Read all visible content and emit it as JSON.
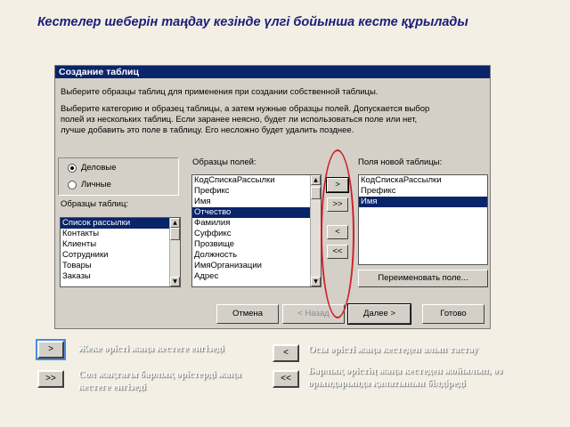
{
  "slide_title": "Кестелер шеберін таңдау кезінде үлгі бойынша кесте құрылады",
  "dialog": {
    "title": "Создание таблиц",
    "intro": "Выберите образцы таблиц для применения при создании собственной таблицы.",
    "instructions": [
      "Выберите категорию и образец таблицы, а затем нужные образцы полей. Допускается выбор",
      "полей из нескольких таблиц. Если заранее неясно, будет ли использоваться поле или нет,",
      "лучше добавить это поле в таблицу. Его несложно будет удалить позднее."
    ],
    "categories": [
      {
        "label": "Деловые",
        "selected": true
      },
      {
        "label": "Личные",
        "selected": false
      }
    ],
    "sample_tables_label": "Образцы таблиц:",
    "sample_tables": [
      "Список рассылки",
      "Контакты",
      "Клиенты",
      "Сотрудники",
      "Товары",
      "Заказы"
    ],
    "sample_tables_selected": 0,
    "sample_fields_label": "Образцы полей:",
    "sample_fields": [
      "КодСпискаРассылки",
      "Префикс",
      "Имя",
      "Отчество",
      "Фамилия",
      "Суффикс",
      "Прозвище",
      "Должность",
      "ИмяОрганизации",
      "Адрес"
    ],
    "sample_fields_selected": 3,
    "new_fields_label": "Поля новой таблицы:",
    "new_fields": [
      "КодСпискаРассылки",
      "Префикс",
      "Имя"
    ],
    "new_fields_selected": 2,
    "move_buttons": [
      ">",
      ">>",
      "<",
      "<<"
    ],
    "rename_button": "Переименовать поле...",
    "footer_buttons": {
      "cancel": "Отмена",
      "back": "< Назад",
      "next": "Далее >",
      "finish": "Готово"
    }
  },
  "legend": [
    {
      "button": ">",
      "text": "Жеке өрісті жаңа кестеге енгізеді"
    },
    {
      "button": "<",
      "text": "Осы өрісті жаңа кестеден алып тастау"
    },
    {
      "button": ">>",
      "text": "Сол жақтағы барлық өрістерді жаңа кестеге енгізеді"
    },
    {
      "button": "<<",
      "text": "Барлық өрістің жаңа кестеден жойылып, өз орындарында қалатынын білдіреді"
    }
  ],
  "colors": {
    "selection": "#0a246a",
    "highlight_ellipse": "#d0202a",
    "title": "#1a1f7a"
  }
}
